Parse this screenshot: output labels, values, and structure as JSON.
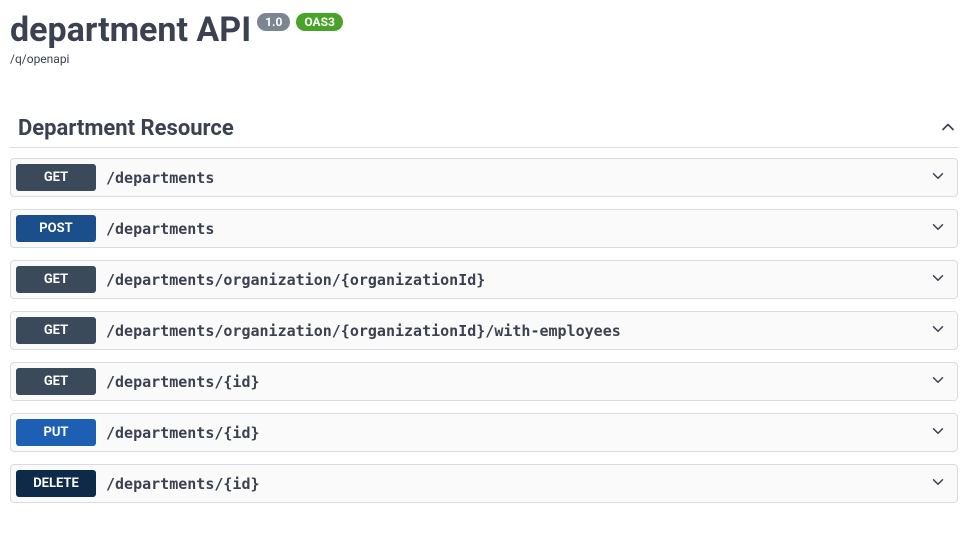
{
  "header": {
    "title": "department API",
    "version": "1.0",
    "oas": "OAS3",
    "spec_url": "/q/openapi"
  },
  "section": {
    "title": "Department Resource"
  },
  "ops": [
    {
      "method": "GET",
      "path": "/departments"
    },
    {
      "method": "POST",
      "path": "/departments"
    },
    {
      "method": "GET",
      "path": "/departments/organization/{organizationId}"
    },
    {
      "method": "GET",
      "path": "/departments/organization/{organizationId}/with-employees"
    },
    {
      "method": "GET",
      "path": "/departments/{id}"
    },
    {
      "method": "PUT",
      "path": "/departments/{id}"
    },
    {
      "method": "DELETE",
      "path": "/departments/{id}"
    }
  ],
  "colors": {
    "get": "#3b4a5a",
    "post": "#1a4f8b",
    "put": "#1d5fb3",
    "delete": "#0d2a49"
  }
}
